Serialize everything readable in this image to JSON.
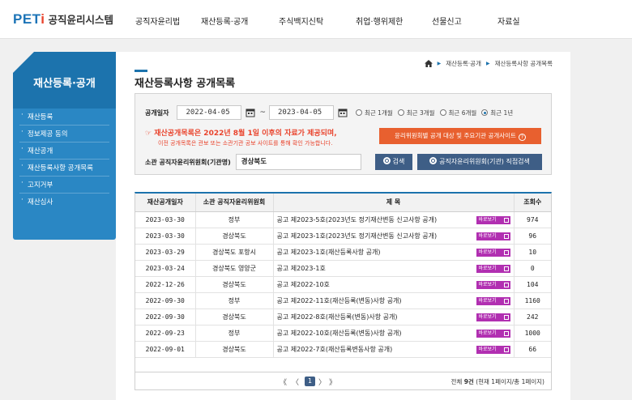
{
  "header": {
    "logo_mark": "PETi",
    "logo_text": "공직윤리시스템",
    "nav": [
      "공직자윤리법",
      "재산등록·공개",
      "주식백지신탁",
      "취업·행위제한",
      "선물신고",
      "자료실"
    ]
  },
  "sidebar": {
    "title": "재산등록·공개",
    "items": [
      "재산등록",
      "정보제공 동의",
      "재산공개",
      "재산등록사항 공개목록",
      "고지거부",
      "재산심사"
    ]
  },
  "breadcrumb": [
    "재산등록·공개",
    "재산등록사항 공개목록"
  ],
  "page_title": "재산등록사항 공개목록",
  "search": {
    "date_label": "공개일자",
    "date_from": "2022-04-05",
    "date_to": "2023-04-05",
    "tilde": "~",
    "periods": [
      "최근 1개월",
      "최근 3개월",
      "최근 6개월",
      "최근 1년"
    ],
    "selected_period": "최근 1년",
    "notice_main": "재산공개목록은 2022년 8월 1일 이후의 자료가 제공되며,",
    "notice_sub": "이전 공개목록은 관보 또는 소관기관 공보 사이트를 통해 확인 가능합니다.",
    "notice_arrow": "☞",
    "orange_button": "윤리위원회별 공개 대상 및 주요기관 공개사이트",
    "committee_label": "소관 공직자윤리위원회(기관명)",
    "committee_value": "경상북도",
    "search_button": "검색",
    "direct_button": "공직자윤리위원회(기관) 직접검색"
  },
  "table": {
    "columns": [
      "재산공개일자",
      "소관 공직자윤리위원회",
      "제 목",
      "조회수"
    ],
    "badge": "바로보기",
    "rows": [
      {
        "date": "2023-03-30",
        "committee": "정부",
        "title": "공고 제2023-5호(2023년도 정기재산변동 신고사항 공개)",
        "views": "974"
      },
      {
        "date": "2023-03-30",
        "committee": "경상북도",
        "title": "공고 제2023-1호(2023년도 정기재산변동 신고사항 공개)",
        "views": "96"
      },
      {
        "date": "2023-03-29",
        "committee": "경상북도 포항시",
        "title": "공고 제2023-1호(재산등록사항 공개)",
        "views": "10"
      },
      {
        "date": "2023-03-24",
        "committee": "경상북도 영양군",
        "title": "공고 제2023-1호",
        "views": "0"
      },
      {
        "date": "2022-12-26",
        "committee": "경상북도",
        "title": "공고 제2022-10호",
        "views": "104"
      },
      {
        "date": "2022-09-30",
        "committee": "정부",
        "title": "공고 제2022-11호(재산등록(변동)사항 공개)",
        "views": "1160"
      },
      {
        "date": "2022-09-30",
        "committee": "경상북도",
        "title": "공고 제2022-8호(재산등록(변동)사항 공개)",
        "views": "242"
      },
      {
        "date": "2022-09-23",
        "committee": "정부",
        "title": "공고 제2022-10호(재산등록(변동)사항 공개)",
        "views": "1000"
      },
      {
        "date": "2022-09-01",
        "committee": "경상북도",
        "title": "공고 제2022-7호(재산등록변동사항 공개)",
        "views": "66"
      }
    ]
  },
  "pagination": {
    "first": "《",
    "prev": "〈",
    "current": "1",
    "next": "〉",
    "last": "》",
    "total_prefix": "전체 ",
    "total_count": "9건",
    "total_suffix": " (현재 1페이지/총 1페이지)"
  },
  "colors": {
    "primary": "#1c73ad",
    "sidebar": "#2a87c4",
    "accent_red": "#e9432c",
    "orange_button": "#e8602f",
    "navy_button": "#3e5e86",
    "badge": "#b12fb1"
  }
}
